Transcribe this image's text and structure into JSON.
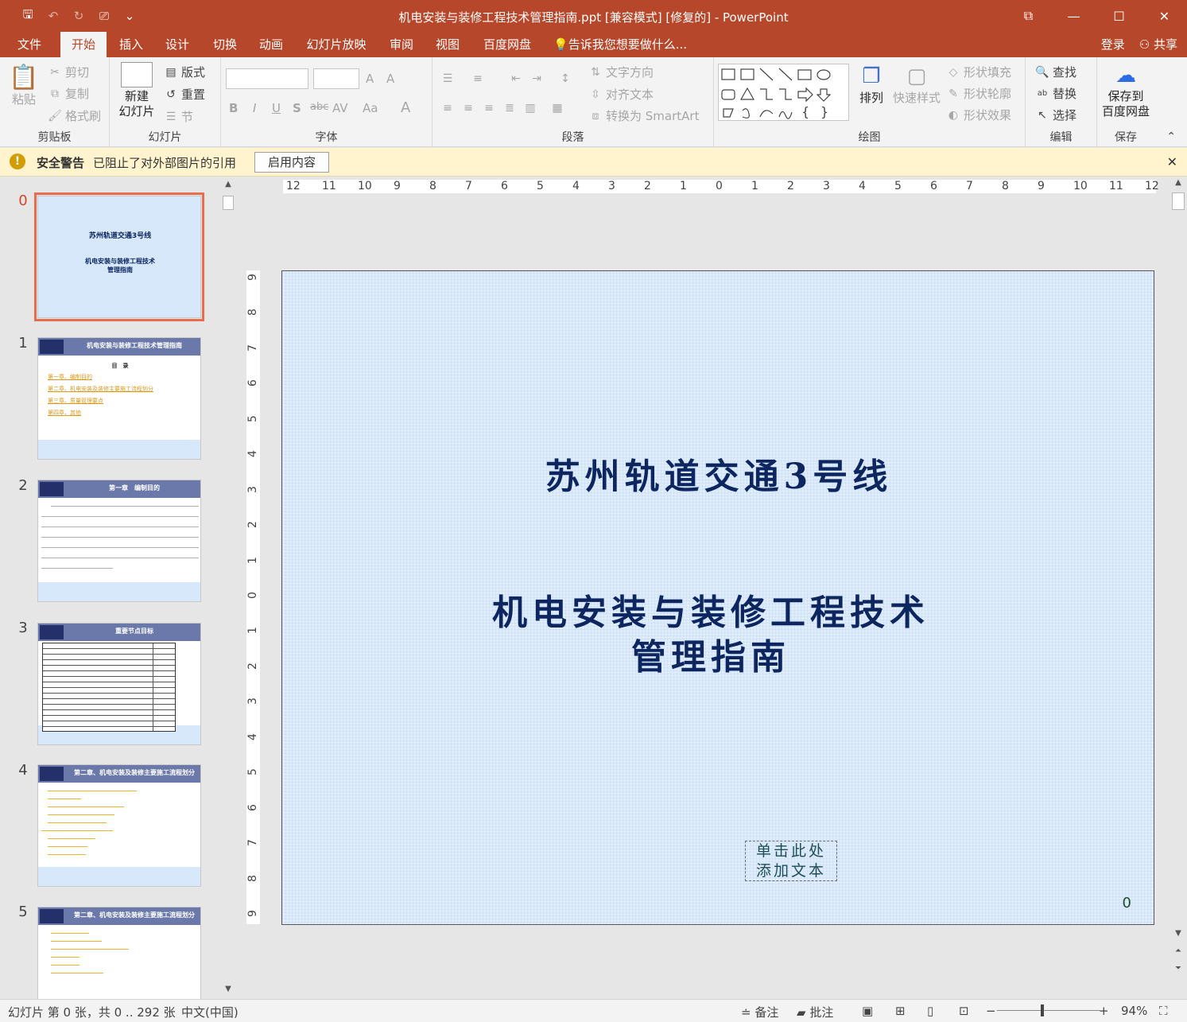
{
  "window": {
    "title": "机电安装与装修工程技术管理指南.ppt [兼容模式] [修复的] - PowerPoint",
    "controls": [
      "⧉",
      "—",
      "☐",
      "✕"
    ]
  },
  "qat": {
    "save": "🖫",
    "undo": "↶",
    "redo": "↻",
    "present": "⎚",
    "more": "⌄"
  },
  "tabs": [
    "文件",
    "开始",
    "插入",
    "设计",
    "切换",
    "动画",
    "幻灯片放映",
    "审阅",
    "视图",
    "百度网盘"
  ],
  "active_tab": "开始",
  "tell_me": "告诉我您想要做什么...",
  "account": {
    "login": "登录",
    "share": "共享"
  },
  "ribbon": {
    "clipboard": {
      "label": "剪贴板",
      "paste": "粘贴",
      "cut": "剪切",
      "copy": "复制",
      "format_painter": "格式刷"
    },
    "slides": {
      "label": "幻灯片",
      "new_slide_1": "新建",
      "new_slide_2": "幻灯片",
      "layout": "版式",
      "reset": "重置",
      "section": "节"
    },
    "font": {
      "label": "字体",
      "bold": "B",
      "italic": "I",
      "underline": "U",
      "shadow": "S",
      "strike": "abc",
      "spacing": "AV",
      "case": "Aa",
      "color": "A",
      "grow": "A",
      "shrink": "A"
    },
    "paragraph": {
      "label": "段落",
      "text_direction": "文字方向",
      "align_text": "对齐文本",
      "smartart": "转换为 SmartArt"
    },
    "drawing": {
      "label": "绘图",
      "arrange": "排列",
      "quick_styles": "快速样式",
      "shape_fill": "形状填充",
      "shape_outline": "形状轮廓",
      "shape_effects": "形状效果"
    },
    "editing": {
      "label": "编辑",
      "find": "查找",
      "replace": "替换",
      "select": "选择"
    },
    "save": {
      "label": "保存",
      "save_to_1": "保存到",
      "save_to_2": "百度网盘"
    }
  },
  "security_bar": {
    "label": "安全警告",
    "message": "已阻止了对外部图片的引用",
    "enable_button": "启用内容"
  },
  "thumbnails": [
    {
      "number": "0",
      "title": "苏州轨道交通3号线",
      "subtitle_1": "机电安装与装修工程技术",
      "subtitle_2": "管理指南"
    },
    {
      "number": "1",
      "header": "机电安装与装修工程技术管理指南",
      "heading": "目　录",
      "items": [
        "第一章、编制目的",
        "第二章、机电安装及装修主要施工流程划分",
        "第三章、质量管理要点",
        "第四章、其他"
      ]
    },
    {
      "number": "2",
      "header": "第一章　编制目的"
    },
    {
      "number": "3",
      "header": "重要节点目标"
    },
    {
      "number": "4",
      "header": "第二章、机电安装及装修主要施工流程划分"
    },
    {
      "number": "5",
      "header": "第二章、机电安装及装修主要施工流程划分"
    }
  ],
  "slide": {
    "title": "苏州轨道交通3号线",
    "subtitle_line1": "机电安装与装修工程技术",
    "subtitle_line2": "管理指南",
    "placeholder_line1": "单击此处",
    "placeholder_line2": "添加文本",
    "number": "0"
  },
  "ruler": {
    "horizontal": [
      "12",
      "11",
      "10",
      "9",
      "8",
      "7",
      "6",
      "5",
      "4",
      "3",
      "2",
      "1",
      "0",
      "1",
      "2",
      "3",
      "4",
      "5",
      "6",
      "7",
      "8",
      "9",
      "10",
      "11",
      "12"
    ],
    "vertical": [
      "9",
      "8",
      "7",
      "6",
      "5",
      "4",
      "3",
      "2",
      "1",
      "0",
      "1",
      "2",
      "3",
      "4",
      "5",
      "6",
      "7",
      "8",
      "9"
    ]
  },
  "status": {
    "slide_info": "幻灯片 第 0 张，共 0 .. 292 张",
    "language": "中文(中国)",
    "notes": "备注",
    "comments": "批注",
    "zoom": "94%"
  },
  "colors": {
    "accent": "#b7472a",
    "slide_bg": "#d8e9fb",
    "title_text": "#0d2660"
  }
}
